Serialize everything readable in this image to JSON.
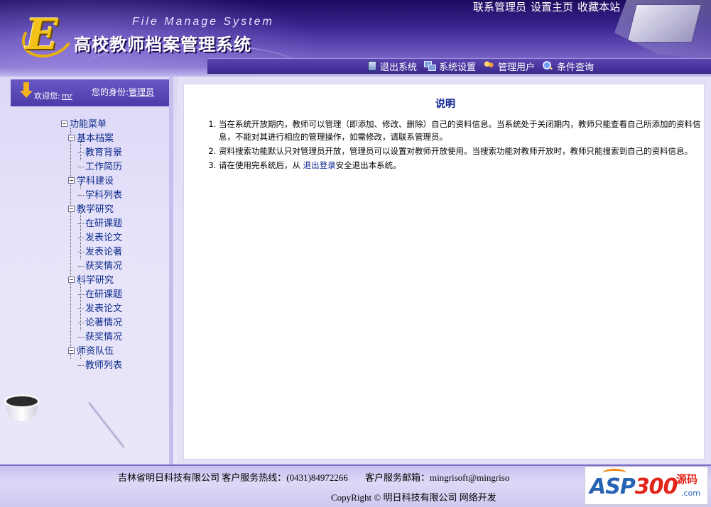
{
  "header": {
    "logo_letter": "E",
    "system_name_en": "File Manage System",
    "system_name_cn": "高校教师档案管理系统",
    "top_links": [
      "联系管理员",
      "设置主页",
      "收藏本站"
    ],
    "nav": [
      {
        "label": "退出系统",
        "icon": "exit-icon"
      },
      {
        "label": "系统设置",
        "icon": "settings-icon"
      },
      {
        "label": "管理用户",
        "icon": "users-icon"
      },
      {
        "label": "条件查询",
        "icon": "search-icon"
      }
    ]
  },
  "sidebar": {
    "welcome_label": "欢迎您:",
    "username": "mr",
    "role_label": "您的身份:",
    "role_value": "管理员",
    "menu_root": "功能菜单",
    "groups": [
      {
        "label": "基本档案",
        "items": [
          "教育背景",
          "工作简历"
        ]
      },
      {
        "label": "学科建设",
        "items": [
          "学科列表"
        ]
      },
      {
        "label": "教学研究",
        "items": [
          "在研课题",
          "发表论文",
          "发表论著",
          "获奖情况"
        ]
      },
      {
        "label": "科学研究",
        "items": [
          "在研课题",
          "发表论文",
          "论著情况",
          "获奖情况"
        ]
      },
      {
        "label": "师资队伍",
        "items": [
          "教师列表"
        ]
      }
    ]
  },
  "main": {
    "title": "说明",
    "notes": [
      "当在系统开放期内，教师可以管理（即添加、修改、删除）自己的资料信息。当系统处于关闭期内，教师只能查看自己所添加的资料信息，不能对其进行相应的管理操作，如需修改，请联系管理员。",
      "资料搜索功能默认只对管理员开放，管理员可以设置对教师开放使用。当搜索功能对教师开放时，教师只能搜索到自己的资料信息。"
    ],
    "note3_prefix": "请在使用完系统后，从 ",
    "note3_link": "退出登录",
    "note3_suffix": "安全退出本系统。"
  },
  "footer": {
    "company": "吉林省明日科技有限公司 客户服务热线：",
    "hotline": "(0431)84972266",
    "email_label": "客户服务邮箱：",
    "email": "mingrisoft@mingriso",
    "copyright": "CopyRight © 明日科技有限公司 网络开发"
  },
  "badge": {
    "asp": "ASP",
    "num": "300",
    "yuanma": "源码",
    "com": ".com"
  },
  "colors": {
    "header_dark": "#1d0c5f",
    "header_light": "#8a78cf",
    "sidebar_bg": "#e7e3fa",
    "menu_text": "#0b2a8a",
    "title_text": "#0a1f8f",
    "logo_gold": "#f3c21a"
  }
}
